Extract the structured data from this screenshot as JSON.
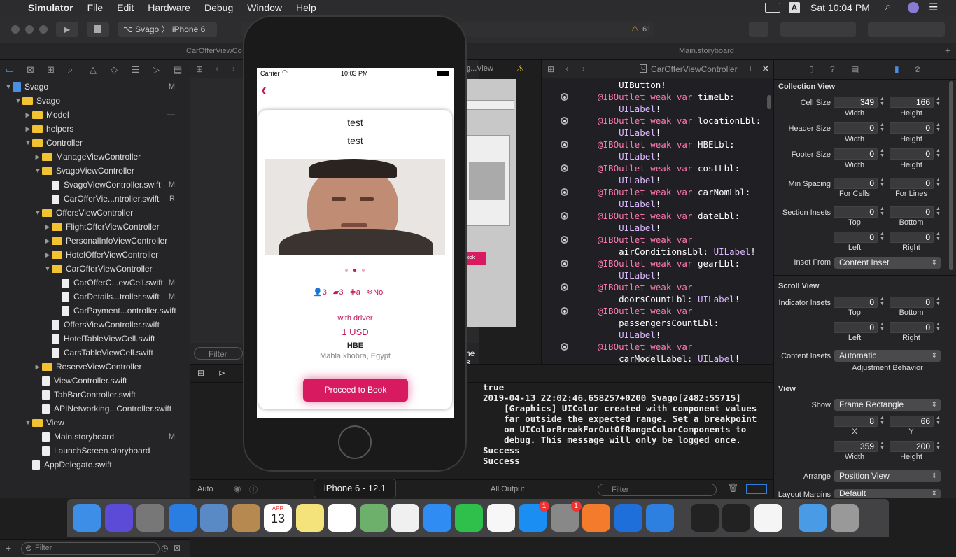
{
  "menubar": {
    "apple_icon": "apple-icon",
    "app": "Simulator",
    "items": [
      "File",
      "Edit",
      "Hardware",
      "Debug",
      "Window",
      "Help"
    ],
    "a_label": "A",
    "clock": "Sat 10:04 PM"
  },
  "toolbar": {
    "scheme": "Svago",
    "device": "iPhone 6",
    "warnings": "61"
  },
  "tabs": {
    "left": "CarOfferViewCo",
    "right": "Main.storyboard"
  },
  "navigator": {
    "items": [
      {
        "label": "Svago",
        "depth": 0,
        "kind": "project",
        "open": true,
        "status": "M"
      },
      {
        "label": "Svago",
        "depth": 1,
        "kind": "folder",
        "open": true,
        "status": ""
      },
      {
        "label": "Model",
        "depth": 2,
        "kind": "folder",
        "open": false,
        "status": "—"
      },
      {
        "label": "helpers",
        "depth": 2,
        "kind": "folder",
        "open": false,
        "status": ""
      },
      {
        "label": "Controller",
        "depth": 2,
        "kind": "folder",
        "open": true,
        "status": ""
      },
      {
        "label": "ManageViewController",
        "depth": 3,
        "kind": "folder",
        "open": false,
        "status": ""
      },
      {
        "label": "SvagoViewController",
        "depth": 3,
        "kind": "folder",
        "open": true,
        "status": ""
      },
      {
        "label": "SvagoViewController.swift",
        "depth": 4,
        "kind": "file",
        "status": "M"
      },
      {
        "label": "CarOfferVie...ntroller.swift",
        "depth": 4,
        "kind": "file",
        "status": "R"
      },
      {
        "label": "OffersViewController",
        "depth": 3,
        "kind": "folder",
        "open": true,
        "status": ""
      },
      {
        "label": "FlightOfferViewController",
        "depth": 4,
        "kind": "folder",
        "open": false,
        "status": ""
      },
      {
        "label": "PersonalInfoViewController",
        "depth": 4,
        "kind": "folder",
        "open": false,
        "status": ""
      },
      {
        "label": "HotelOfferViewController",
        "depth": 4,
        "kind": "folder",
        "open": false,
        "status": ""
      },
      {
        "label": "CarOfferViewController",
        "depth": 4,
        "kind": "folder",
        "open": true,
        "status": ""
      },
      {
        "label": "CarOfferC...ewCell.swift",
        "depth": 5,
        "kind": "file",
        "status": "M"
      },
      {
        "label": "CarDetails...troller.swift",
        "depth": 5,
        "kind": "file",
        "status": "M"
      },
      {
        "label": "CarPayment...ontroller.swift",
        "depth": 5,
        "kind": "file",
        "status": ""
      },
      {
        "label": "OffersViewController.swift",
        "depth": 4,
        "kind": "file",
        "status": ""
      },
      {
        "label": "HotelTableViewCell.swift",
        "depth": 4,
        "kind": "file",
        "status": ""
      },
      {
        "label": "CarsTableViewCell.swift",
        "depth": 4,
        "kind": "file",
        "status": ""
      },
      {
        "label": "ReserveViewController",
        "depth": 3,
        "kind": "folder",
        "open": false,
        "status": ""
      },
      {
        "label": "ViewController.swift",
        "depth": 3,
        "kind": "file",
        "status": ""
      },
      {
        "label": "TabBarController.swift",
        "depth": 3,
        "kind": "file",
        "status": ""
      },
      {
        "label": "APINetworking...Controller.swift",
        "depth": 3,
        "kind": "file",
        "status": ""
      },
      {
        "label": "View",
        "depth": 2,
        "kind": "folder",
        "open": true,
        "status": ""
      },
      {
        "label": "Main.storyboard",
        "depth": 3,
        "kind": "file",
        "status": "M"
      },
      {
        "label": "LaunchScreen.storyboard",
        "depth": 3,
        "kind": "file",
        "status": ""
      },
      {
        "label": "AppDelegate.swift",
        "depth": 2,
        "kind": "file",
        "status": ""
      }
    ],
    "filter_placeholder": "Filter"
  },
  "editor": {
    "jump_title": "g...View",
    "filter_placeholder": "Filter",
    "size_class": "ne 8 (wC hR)",
    "zoom": "Auto",
    "button_label": "ook"
  },
  "code": {
    "breadcrumb": "CarOfferViewController",
    "lines": [
      {
        "dot": false,
        "parts": [
          [
            "",
            "    UIButton!"
          ]
        ]
      },
      {
        "dot": true,
        "parts": [
          [
            "kw",
            "@IBOutlet weak var "
          ],
          [
            "",
            "timeLb:"
          ]
        ]
      },
      {
        "dot": false,
        "parts": [
          [
            "ty",
            "    UILabel"
          ],
          [
            "",
            "!"
          ]
        ]
      },
      {
        "dot": true,
        "parts": [
          [
            "kw",
            "@IBOutlet weak var "
          ],
          [
            "",
            "locationLbl:"
          ]
        ]
      },
      {
        "dot": false,
        "parts": [
          [
            "ty",
            "    UILabel"
          ],
          [
            "",
            "!"
          ]
        ]
      },
      {
        "dot": true,
        "parts": [
          [
            "kw",
            "@IBOutlet weak var "
          ],
          [
            "",
            "HBELbl:"
          ]
        ]
      },
      {
        "dot": false,
        "parts": [
          [
            "ty",
            "    UILabel"
          ],
          [
            "",
            "!"
          ]
        ]
      },
      {
        "dot": true,
        "parts": [
          [
            "kw",
            "@IBOutlet weak var "
          ],
          [
            "",
            "costLbl:"
          ]
        ]
      },
      {
        "dot": false,
        "parts": [
          [
            "ty",
            "    UILabel"
          ],
          [
            "",
            "!"
          ]
        ]
      },
      {
        "dot": true,
        "parts": [
          [
            "kw",
            "@IBOutlet weak var "
          ],
          [
            "",
            "carNomLbl:"
          ]
        ]
      },
      {
        "dot": false,
        "parts": [
          [
            "ty",
            "    UILabel"
          ],
          [
            "",
            "!"
          ]
        ]
      },
      {
        "dot": true,
        "parts": [
          [
            "kw",
            "@IBOutlet weak var "
          ],
          [
            "",
            "dateLbl:"
          ]
        ]
      },
      {
        "dot": false,
        "parts": [
          [
            "ty",
            "    UILabel"
          ],
          [
            "",
            "!"
          ]
        ]
      },
      {
        "dot": true,
        "parts": [
          [
            "kw",
            "@IBOutlet weak var"
          ]
        ]
      },
      {
        "dot": false,
        "parts": [
          [
            "",
            "    airConditionsLbl: "
          ],
          [
            "ty",
            "UILabel"
          ],
          [
            "",
            "!"
          ]
        ]
      },
      {
        "dot": true,
        "parts": [
          [
            "kw",
            "@IBOutlet weak var "
          ],
          [
            "",
            "gearLbl:"
          ]
        ]
      },
      {
        "dot": false,
        "parts": [
          [
            "ty",
            "    UILabel"
          ],
          [
            "",
            "!"
          ]
        ]
      },
      {
        "dot": true,
        "parts": [
          [
            "kw",
            "@IBOutlet weak var"
          ]
        ]
      },
      {
        "dot": false,
        "parts": [
          [
            "",
            "    doorsCountLbl: "
          ],
          [
            "ty",
            "UILabel"
          ],
          [
            "",
            "!"
          ]
        ]
      },
      {
        "dot": true,
        "parts": [
          [
            "kw",
            "@IBOutlet weak var"
          ]
        ]
      },
      {
        "dot": false,
        "parts": [
          [
            "",
            "    passengersCountLbl:"
          ]
        ]
      },
      {
        "dot": false,
        "parts": [
          [
            "ty",
            "    UILabel"
          ],
          [
            "",
            "!"
          ]
        ]
      },
      {
        "dot": true,
        "parts": [
          [
            "kw",
            "@IBOutlet weak var"
          ]
        ]
      },
      {
        "dot": false,
        "parts": [
          [
            "",
            "    carModelLabel: "
          ],
          [
            "ty",
            "UILabel"
          ],
          [
            "",
            "!"
          ]
        ]
      }
    ]
  },
  "console": {
    "text": "true\n2019-04-13 22:02:46.658257+0200 Svago[2482:55715]\n    [Graphics] UIColor created with component values\n    far outside the expected range. Set a breakpoint\n    on UIColorBreakForOutOfRangeColorComponents to\n    debug. This message will only be logged once.\nSuccess\nSuccess",
    "output_select": "All Output",
    "filter_placeholder": "Filter"
  },
  "inspector": {
    "collection_view": "Collection View",
    "cell_size": "Cell Size",
    "cell_w": "349",
    "cell_h": "166",
    "header_size": "Header Size",
    "header_w": "0",
    "header_h": "0",
    "footer_size": "Footer Size",
    "footer_w": "0",
    "footer_h": "0",
    "min_spacing": "Min Spacing",
    "min_cells": "0",
    "min_lines": "0",
    "for_cells": "For Cells",
    "for_lines": "For Lines",
    "section_insets": "Section Insets",
    "si_top": "0",
    "si_bottom": "0",
    "si_left": "0",
    "si_right": "0",
    "inset_from": "Inset From",
    "inset_from_val": "Content Inset",
    "scroll_view": "Scroll View",
    "indicator_insets": "Indicator Insets",
    "ii_top": "0",
    "ii_bottom": "0",
    "ii_left": "0",
    "ii_right": "0",
    "content_insets": "Content Insets",
    "content_insets_val": "Automatic",
    "adjustment": "Adjustment Behavior",
    "view": "View",
    "show": "Show",
    "show_val": "Frame Rectangle",
    "x": "8",
    "y": "66",
    "w": "359",
    "h": "200",
    "arrange": "Arrange",
    "arrange_val": "Position View",
    "layout_margins": "Layout Margins",
    "layout_val": "Default",
    "width": "Width",
    "height": "Height",
    "top": "Top",
    "bottom": "Bottom",
    "left": "Left",
    "right": "Right",
    "X": "X",
    "Y": "Y"
  },
  "phone": {
    "carrier": "Carrier",
    "time": "10:03 PM",
    "title1": "test",
    "title2": "test",
    "features": [
      "3",
      "3",
      "a",
      "No"
    ],
    "with_driver": "with driver",
    "price": "1 USD",
    "code": "HBE",
    "location": "Mahla khobra, Egypt",
    "book": "Proceed to Book",
    "sim_label": "iPhone 6 - 12.1",
    "accent": "#c2185b"
  },
  "dock": {
    "icons": [
      "finder-icon",
      "siri-icon",
      "launchpad-icon",
      "safari-icon",
      "mail-icon",
      "contacts-icon",
      "calendar-icon",
      "notes-icon",
      "reminders-icon",
      "maps-icon",
      "photos-icon",
      "messages-icon",
      "facetime-icon",
      "itunes-icon",
      "app-store-icon",
      "system-preferences-icon",
      "sketch-icon",
      "xcode-icon",
      "simulator-icon",
      "activity-monitor-icon",
      "terminal-icon",
      "textedit-icon",
      "folder-icon",
      "trash-icon"
    ],
    "calendar_month": "APR",
    "calendar_day": "13",
    "badges": [
      "1",
      "1"
    ]
  }
}
